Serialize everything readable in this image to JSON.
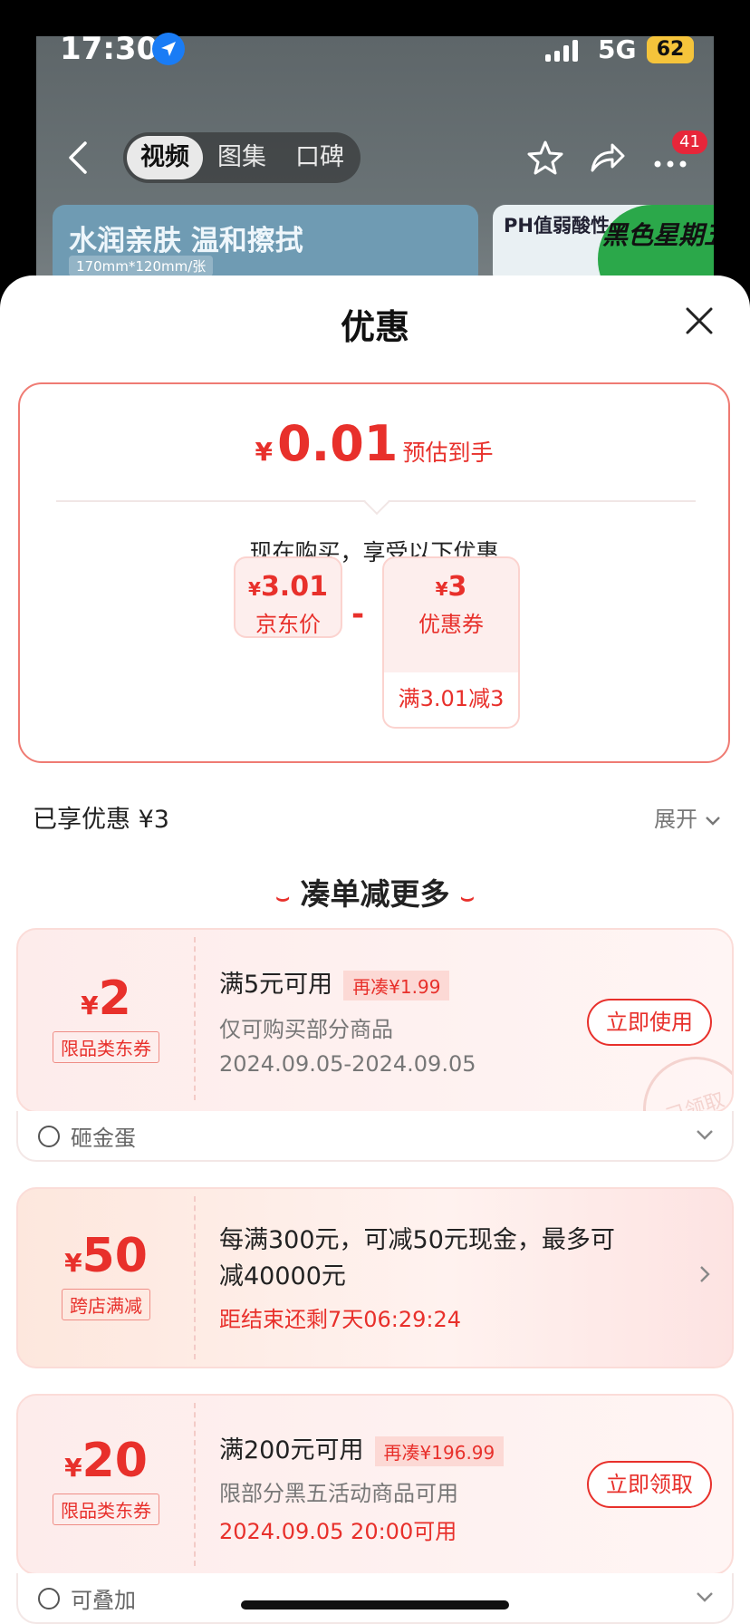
{
  "status": {
    "time": "17:30",
    "network": "5G",
    "battery": "62"
  },
  "nav": {
    "tabs": [
      "视频",
      "图集",
      "口碑"
    ],
    "badge": "41"
  },
  "banner": {
    "title": "水润亲肤 温和擦拭",
    "subtitle": "170mm*120mm/张",
    "right_title": "PH值弱酸性 护肤刚刚好",
    "promo": "黑色星期五"
  },
  "sheet": {
    "title": "优惠",
    "estimate": {
      "currency": "¥",
      "value": "0.01",
      "label": "预估到手"
    },
    "subhead": "现在购买，享受以下优惠",
    "jd_price": {
      "currency": "¥",
      "value": "3.01",
      "label": "京东价"
    },
    "minus": "-",
    "coupon_box": {
      "currency": "¥",
      "value": "3",
      "label": "优惠券",
      "condition": "满3.01减3"
    },
    "enjoyed": "已享优惠 ¥3",
    "expand": "展开",
    "section": "凑单减更多"
  },
  "coupons": [
    {
      "currency": "¥",
      "amount": "2",
      "tag": "限品类东券",
      "title": "满5元可用",
      "more": "再凑¥1.99",
      "desc": "仅可购买部分商品",
      "date": "2024.09.05-2024.09.05",
      "button": "立即使用",
      "stamp": "已领取",
      "footer": "砸金蛋"
    },
    {
      "currency": "¥",
      "amount": "50",
      "tag": "跨店满减",
      "title_line1": "每满300元，可减50元现金，最多可",
      "title_line2": "减40000元",
      "countdown": "距结束还剩7天06:29:24"
    },
    {
      "currency": "¥",
      "amount": "20",
      "tag": "限品类东券",
      "title": "满200元可用",
      "more": "再凑¥196.99",
      "desc": "限部分黑五活动商品可用",
      "date": "2024.09.05 20:00可用",
      "button": "立即领取",
      "footer": "可叠加"
    }
  ],
  "colors": {
    "accent": "#e8302b",
    "coupon_bg": "#fdeceb"
  }
}
